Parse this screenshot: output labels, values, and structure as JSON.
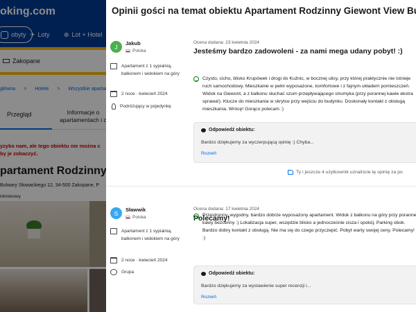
{
  "background": {
    "logo": "oking.com",
    "tabs": [
      "obyty",
      "Loty",
      "Lot + Hotel"
    ],
    "search_value": "Zakopane",
    "breadcrumbs": [
      "główna",
      ">",
      "Hotele",
      ">",
      "Wszystkie apartamenty"
    ],
    "tab_overview": "Przegląd",
    "tab_info": "Informacje o apartamentach i c",
    "alert_line1": "yzyko nam, ale tego obiektu nie można c",
    "alert_line2": "by je zobaczyć.",
    "property_title": "partament Rodzinny Bulw",
    "address": "Bulwary Słowackiego 12, 34-500 Zakopane, P",
    "airport_note": "lotniskowy"
  },
  "panel": {
    "title": "Opinii gości na temat obiektu Apartament Rodzinny Giewont View Bulwary"
  },
  "reviews": [
    {
      "initial": "J",
      "name": "Jakub",
      "country": "Polska",
      "room": "Apartament z 1 sypialnią, balkonem i widokiem na góry",
      "stay": "2 noce · kwiecień 2024",
      "traveler": "Podróżujący w pojedynkę",
      "date": "Ocena dodana: 23 kwietnia 2024",
      "headline": "Jesteśmy bardzo zadowoleni - za nami mega udany pobyt! :)",
      "text": "Czysto, cicho, blisko Krupówek i drogi do Kuźnic, w bocznej ulicy, przy której praktycznie nie istnieje ruch samochodowy. Mieszkanie w pełni wyposażone, komfortowe i z fajnym układem pomieszczeń. Widok na Giewont, a z balkonu słuchać szum przepływającego strumyka (przy porannej kawie ekstra sprawa!). Klucze do mieszkania w skrytce przy wejściu do budynku. Doskonały kontakt z obsługą mieszkania. Wrócę! Gorąco polecam :)",
      "reply_title": "Odpowiedź obiektu:",
      "reply_text": "Bardzo dziękujemy za wyczerpującą opinię :) Chyba...",
      "reply_more": "Rozwiń",
      "helpful": "Ty i jeszcze 4 użytkownik uznaliście tę opinię za po"
    },
    {
      "initial": "S",
      "name": "Sławwik",
      "country": "Polska",
      "room": "Apartament z 1 sypialnią, balkonem i widokiem na góry",
      "stay": "2 noce · kwiecień 2024",
      "traveler": "Grupa",
      "date": "Ocena dodana: 17 kwietnia 2024",
      "headline": "Polecamy!",
      "text": "Przestronny, wygodny, bardzo dobrze wyposażony apartament. Widok z balkonu na góry przy porannej kawy bezcenny :) Lokalizacja super, wszędzie blisko a jednocześnie cisza i spokój. Parking obok. Bardzo dobry kontakt z obsługą. Nie ma się do czego przyczepić. Pobyt warty swojej ceny. Polecamy! :)",
      "reply_title": "Odpowiedź obiektu:",
      "reply_text": "Bardzo dziękujemy za wystawienie super recenzji i...",
      "reply_more": "Rozwiń"
    }
  ],
  "colors": {
    "brand_blue": "#003b95",
    "brand_yellow": "#febb02",
    "link_blue": "#006ce4",
    "positive_green": "#008009"
  }
}
